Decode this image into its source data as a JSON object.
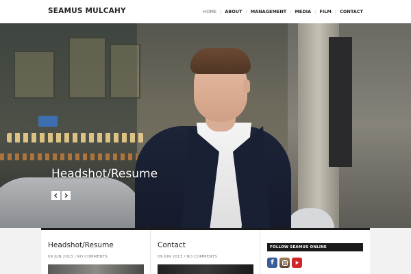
{
  "header": {
    "site_title": "SEAMUS MULCAHY",
    "nav": [
      {
        "label": "HOME",
        "active": true
      },
      {
        "label": "ABOUT",
        "active": false
      },
      {
        "label": "MANAGEMENT",
        "active": false
      },
      {
        "label": "MEDIA",
        "active": false
      },
      {
        "label": "FILM",
        "active": false
      },
      {
        "label": "CONTACT",
        "active": false
      }
    ]
  },
  "hero": {
    "caption": "Headshot/Resume",
    "prev_icon": "chevron-left-icon",
    "next_icon": "chevron-right-icon"
  },
  "posts": [
    {
      "title": "Headshot/Resume",
      "meta": "09 JUN 2013 / NO COMMENTS"
    },
    {
      "title": "Contact",
      "meta": "09 JUN 2013 / NO COMMENTS"
    }
  ],
  "widget": {
    "title": "FOLLOW SEAMUS ONLINE",
    "icons": [
      "facebook-icon",
      "instagram-icon",
      "youtube-icon"
    ]
  },
  "colors": {
    "accent_dark": "#1a1a1a",
    "facebook": "#3b5c99",
    "youtube": "#d0262a"
  }
}
